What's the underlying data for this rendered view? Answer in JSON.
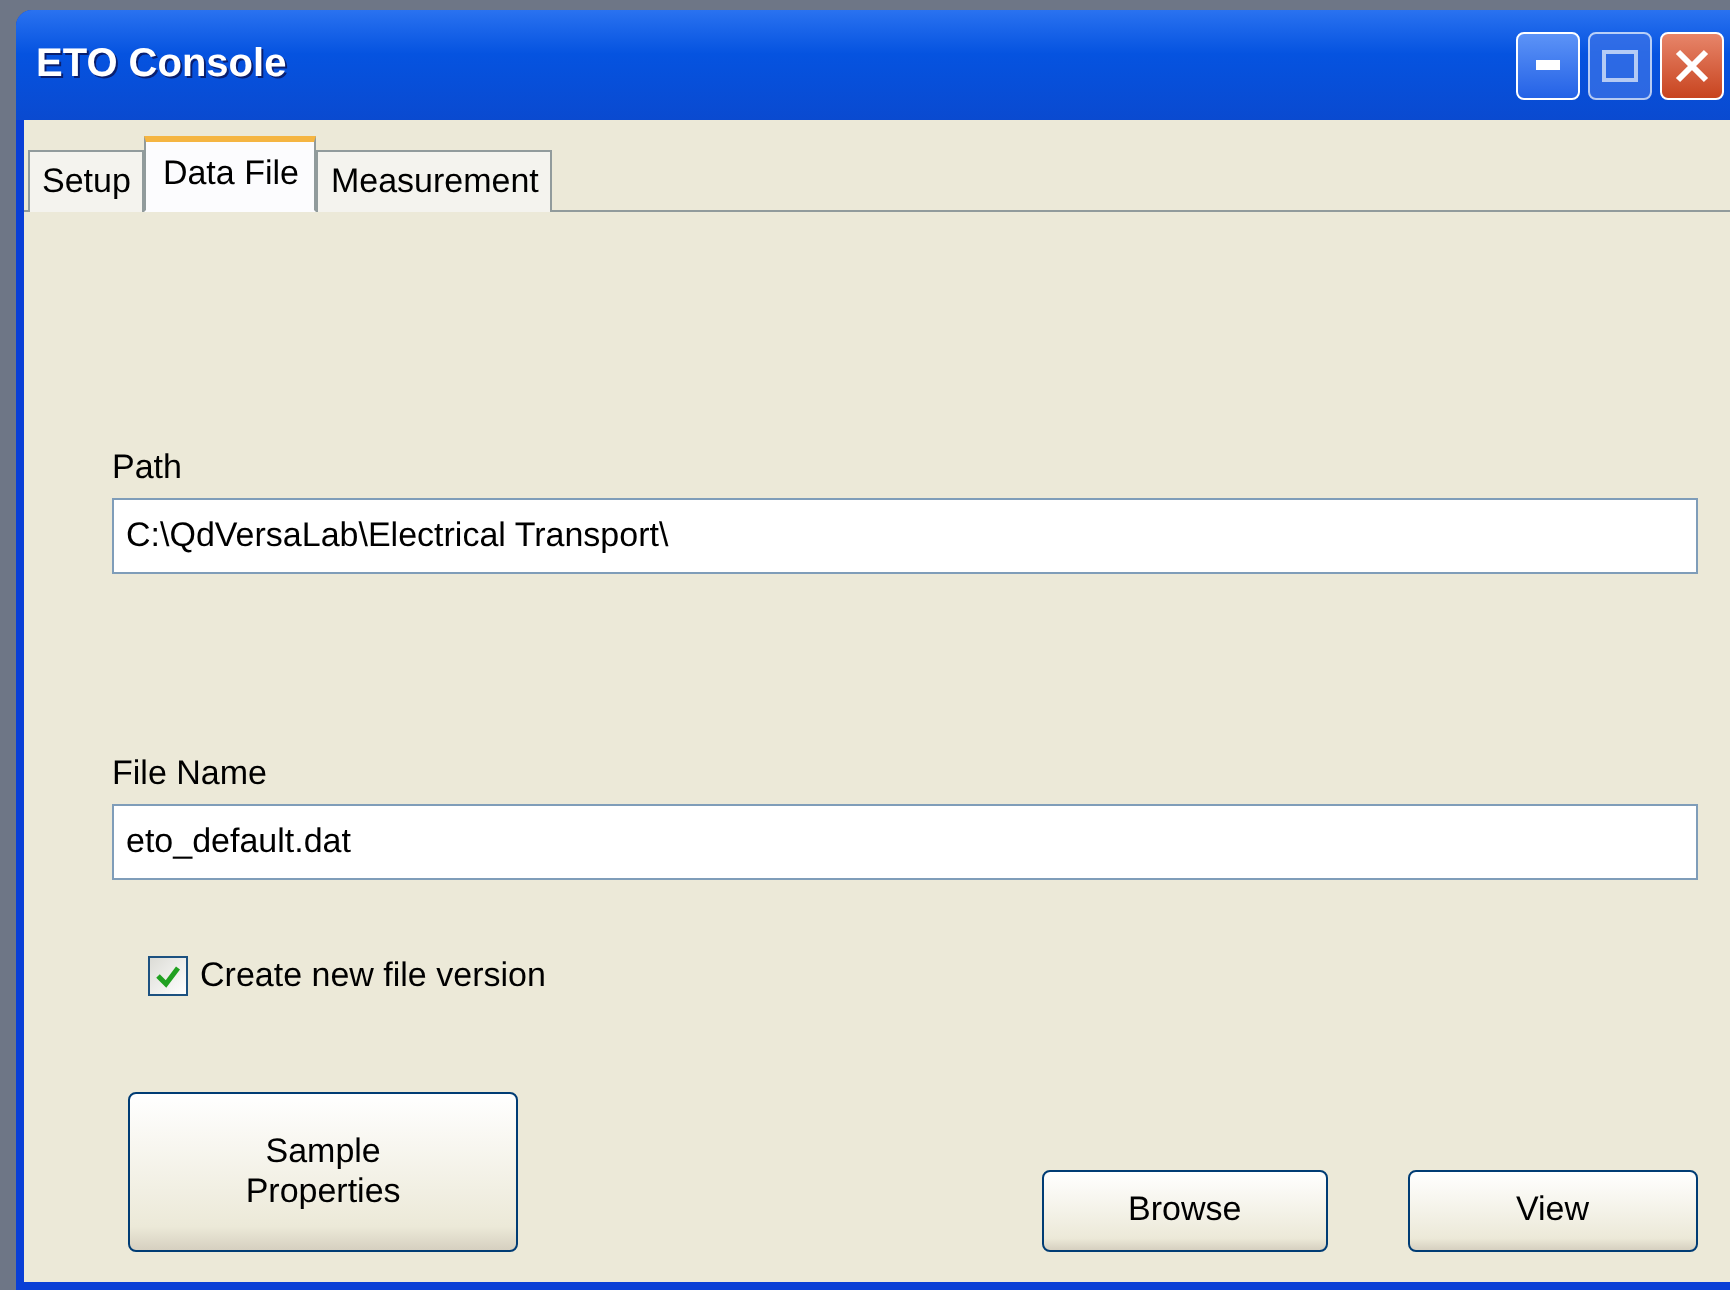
{
  "window": {
    "title": "ETO Console"
  },
  "tabs": [
    {
      "label": "Setup",
      "selected": false
    },
    {
      "label": "Data File",
      "selected": true
    },
    {
      "label": "Measurement",
      "selected": false
    }
  ],
  "path": {
    "label": "Path",
    "value": "C:\\QdVersaLab\\Electrical Transport\\"
  },
  "file_name": {
    "label": "File Name",
    "value": "eto_default.dat"
  },
  "create_new_version": {
    "label": "Create new file version",
    "checked": true
  },
  "buttons": [
    "Sample Properties",
    "Browse",
    "View"
  ]
}
